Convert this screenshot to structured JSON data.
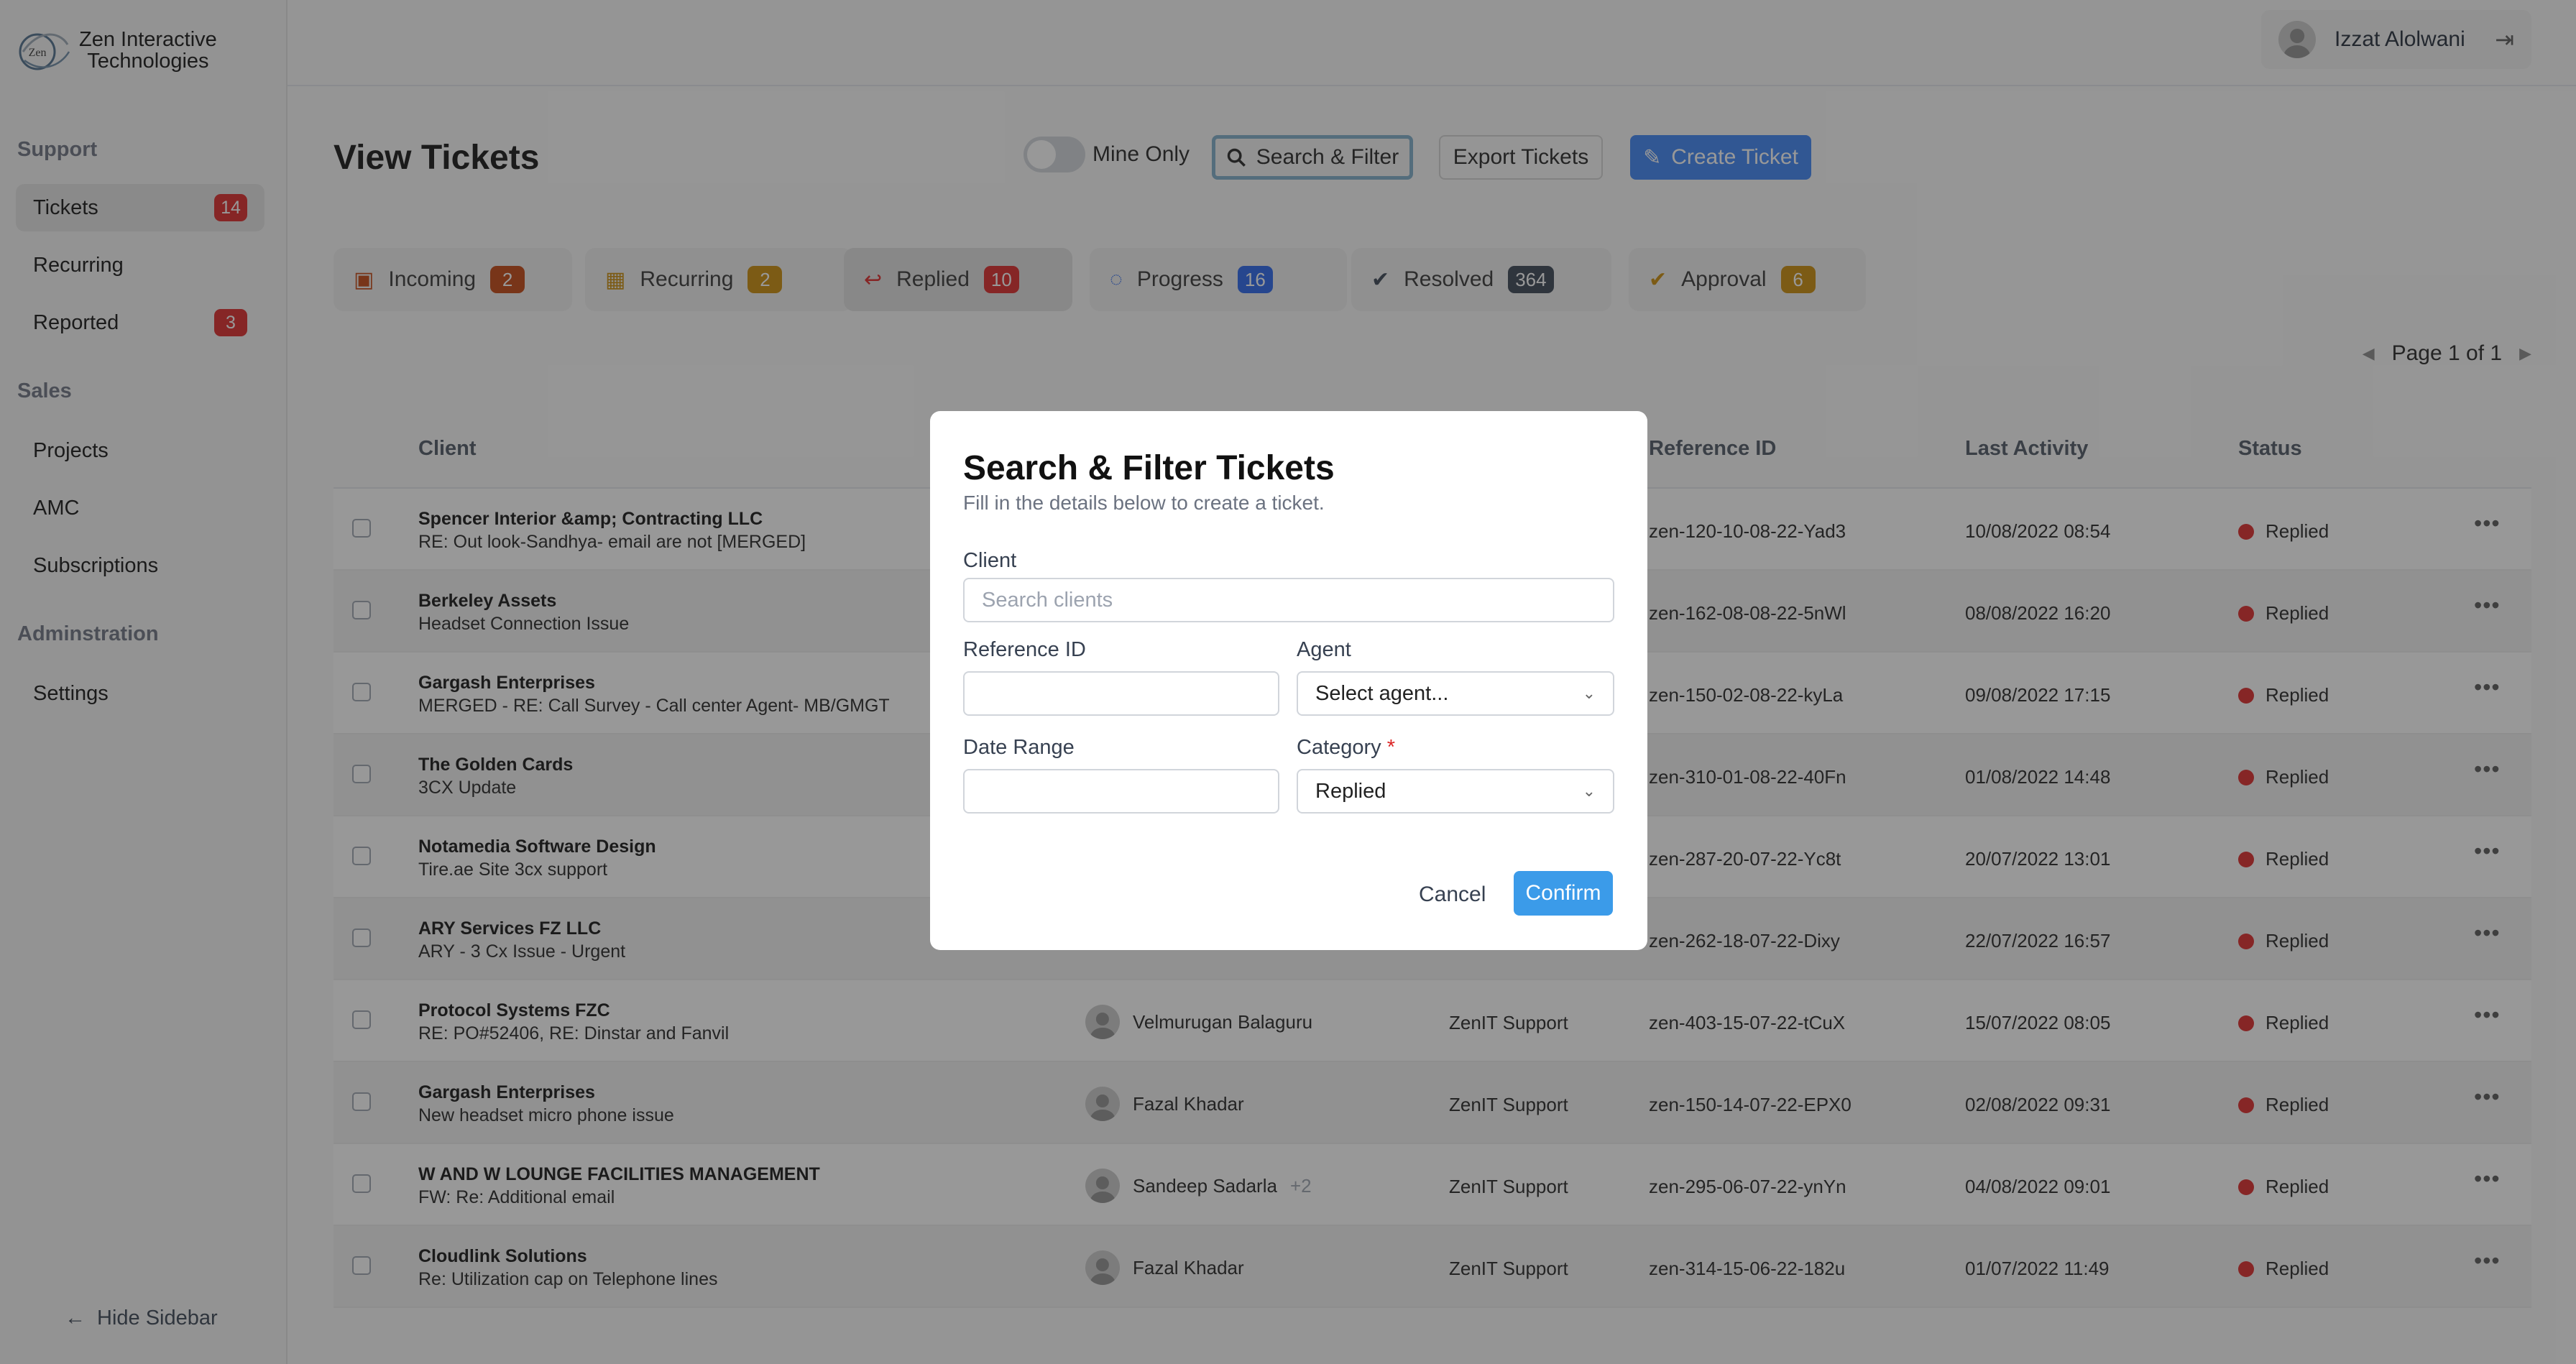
{
  "brand": {
    "line1": "Zen Interactive",
    "line2": "Technologies",
    "mark": "Zen"
  },
  "sidebar": {
    "sections": [
      {
        "title": "Support",
        "items": [
          {
            "label": "Tickets",
            "badge": "14",
            "active": true
          },
          {
            "label": "Recurring",
            "badge": ""
          },
          {
            "label": "Reported",
            "badge": "3"
          }
        ]
      },
      {
        "title": "Sales",
        "items": [
          {
            "label": "Projects"
          },
          {
            "label": "AMC"
          },
          {
            "label": "Subscriptions"
          }
        ]
      },
      {
        "title": "Adminstration",
        "items": [
          {
            "label": "Settings"
          }
        ]
      }
    ],
    "hide_label": "Hide Sidebar"
  },
  "user": {
    "name": "Izzat Alolwani"
  },
  "page": {
    "title": "View Tickets",
    "mine_only": "Mine Only",
    "search_filter": "Search & Filter",
    "export": "Export Tickets",
    "create": "Create Ticket",
    "pager": "Page 1 of 1"
  },
  "tabs": [
    {
      "label": "Incoming",
      "count": "2",
      "color": "#c2410c",
      "icon": "inbox-icon"
    },
    {
      "label": "Recurring",
      "count": "2",
      "color": "#ca8a04",
      "icon": "calendar-icon"
    },
    {
      "label": "Replied",
      "count": "10",
      "color": "#dc2626",
      "icon": "reply-icon"
    },
    {
      "label": "Progress",
      "count": "16",
      "color": "#2563eb",
      "icon": "spinner-icon"
    },
    {
      "label": "Resolved",
      "count": "364",
      "color": "#374151",
      "icon": "check-circle-icon"
    },
    {
      "label": "Approval",
      "count": "6",
      "color": "#ca8a04",
      "icon": "check-circle-icon"
    }
  ],
  "table": {
    "headers": {
      "client": "Client",
      "ref": "Reference ID",
      "last": "Last Activity",
      "status": "Status"
    },
    "rows": [
      {
        "name": "Spencer Interior &amp; Contracting LLC",
        "sub": "RE: Out look-Sandhya- email are not [MERGED]",
        "agent": "",
        "extra": "",
        "team": "",
        "ref": "zen-120-10-08-22-Yad3",
        "last": "10/08/2022 08:54",
        "status": "Replied"
      },
      {
        "name": "Berkeley Assets",
        "sub": "Headset Connection Issue",
        "agent": "",
        "extra": "",
        "team": "",
        "ref": "zen-162-08-08-22-5nWl",
        "last": "08/08/2022 16:20",
        "status": "Replied"
      },
      {
        "name": "Gargash Enterprises",
        "sub": "MERGED - RE: Call Survey - Call center Agent- MB/GMGT",
        "agent": "",
        "extra": "",
        "team": "",
        "ref": "zen-150-02-08-22-kyLa",
        "last": "09/08/2022 17:15",
        "status": "Replied"
      },
      {
        "name": "The Golden Cards",
        "sub": "3CX Update",
        "agent": "",
        "extra": "",
        "team": "",
        "ref": "zen-310-01-08-22-40Fn",
        "last": "01/08/2022 14:48",
        "status": "Replied"
      },
      {
        "name": "Notamedia Software Design",
        "sub": "Tire.ae Site 3cx support",
        "agent": "",
        "extra": "",
        "team": "",
        "ref": "zen-287-20-07-22-Yc8t",
        "last": "20/07/2022 13:01",
        "status": "Replied"
      },
      {
        "name": "ARY Services FZ LLC",
        "sub": "ARY - 3 Cx Issue - Urgent",
        "agent": "",
        "extra": "",
        "team": "",
        "ref": "zen-262-18-07-22-Dixy",
        "last": "22/07/2022 16:57",
        "status": "Replied"
      },
      {
        "name": "Protocol Systems FZC",
        "sub": "RE: PO#52406, RE: Dinstar and Fanvil",
        "agent": "Velmurugan Balaguru",
        "extra": "",
        "team": "ZenIT Support",
        "ref": "zen-403-15-07-22-tCuX",
        "last": "15/07/2022 08:05",
        "status": "Replied"
      },
      {
        "name": "Gargash Enterprises",
        "sub": "New headset micro phone issue",
        "agent": "Fazal Khadar",
        "extra": "",
        "team": "ZenIT Support",
        "ref": "zen-150-14-07-22-EPX0",
        "last": "02/08/2022 09:31",
        "status": "Replied"
      },
      {
        "name": "W AND W LOUNGE FACILITIES MANAGEMENT",
        "sub": "FW: Re: Additional email",
        "agent": "Sandeep Sadarla",
        "extra": "+2",
        "team": "ZenIT Support",
        "ref": "zen-295-06-07-22-ynYn",
        "last": "04/08/2022 09:01",
        "status": "Replied"
      },
      {
        "name": "Cloudlink Solutions",
        "sub": "Re: Utilization cap on Telephone lines",
        "agent": "Fazal Khadar",
        "extra": "",
        "team": "ZenIT Support",
        "ref": "zen-314-15-06-22-182u",
        "last": "01/07/2022 11:49",
        "status": "Replied"
      }
    ]
  },
  "modal": {
    "title": "Search & Filter Tickets",
    "subtitle": "Fill in the details below to create a ticket.",
    "client_label": "Client",
    "client_placeholder": "Search clients",
    "ref_label": "Reference ID",
    "agent_label": "Agent",
    "agent_value": "Select agent...",
    "date_label": "Date Range",
    "category_label": "Category",
    "category_required": "*",
    "category_value": "Replied",
    "cancel": "Cancel",
    "confirm": "Confirm"
  }
}
